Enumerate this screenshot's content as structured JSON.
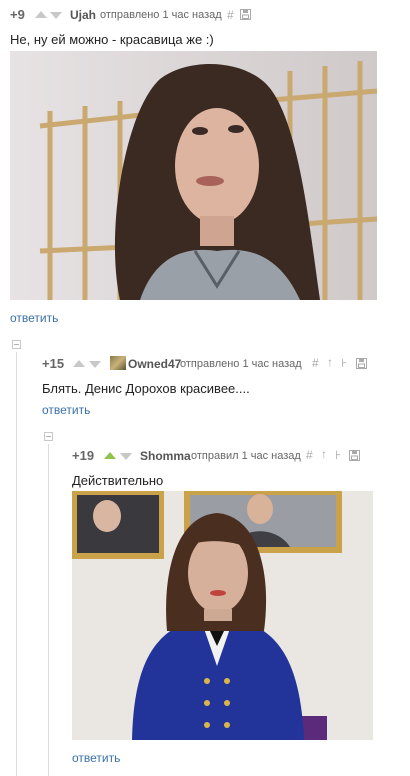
{
  "comments": [
    {
      "rating": "+9",
      "author": "Ujah",
      "meta": "отправлено 1 час назад",
      "text": "Не, ну ей можно - красавица же :)",
      "reply": "ответить",
      "icons": [
        "hash-icon",
        "save-icon"
      ]
    },
    {
      "rating": "+15",
      "author": "Owned47",
      "meta": "отправлено 1 час назад",
      "text": "Блять. Денис Дорохов красивее....",
      "reply": "ответить",
      "icons": [
        "hash-icon",
        "parent-icon",
        "branch-icon",
        "save-icon"
      ]
    },
    {
      "rating": "+19",
      "author": "Shomma",
      "meta": "отправил 1 час назад",
      "text": "Действительно",
      "reply": "ответить",
      "icons": [
        "hash-icon",
        "parent-icon",
        "branch-icon",
        "save-icon"
      ]
    }
  ],
  "colors": {
    "link": "#3a6fa8",
    "vote_up_active": "#8fc44a",
    "vote_inactive": "#c8c8c8"
  }
}
